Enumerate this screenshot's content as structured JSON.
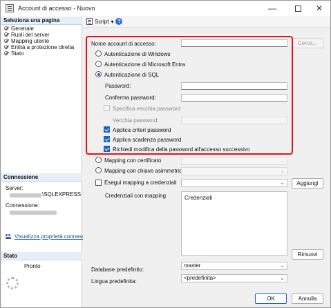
{
  "window": {
    "title": "Account di accesso - Nuovo",
    "minimize_glyph": "—",
    "close_glyph": "✕"
  },
  "sidebar": {
    "select_page_header": "Seleziona una pagina",
    "pages": [
      {
        "label": "Generale",
        "icon": "wrench-icon"
      },
      {
        "label": "Ruoli del server",
        "icon": "wrench-icon"
      },
      {
        "label": "Mapping utente",
        "icon": "wrench-icon"
      },
      {
        "label": "Entità a protezione diretta",
        "icon": "wrench-icon"
      },
      {
        "label": "Stato",
        "icon": "wrench-icon"
      }
    ],
    "connection_header": "Connessione",
    "server_label": "Server:",
    "server_value": "\\SQLEXPRESS",
    "connection_label": "Connessione:",
    "view_props_link": "Visualizza proprietà connessione",
    "status_header": "Stato",
    "status_value": "Pronto"
  },
  "toolbar": {
    "script_label": "Script",
    "dropdown_glyph": "▾",
    "help_glyph": "?"
  },
  "form": {
    "login_name_label": "Nome account di accesso:",
    "login_name_value": "",
    "search_button": "Cerca...",
    "auth_windows": "Autenticazione di Windows",
    "auth_entra": "Autenticazione di Microsoft Entra",
    "auth_sql": "Autenticazione di SQL",
    "auth_selected": "sql",
    "password_label": "Password:",
    "confirm_password_label": "Conferma password:",
    "specify_old_password": "Specifica vecchia password",
    "old_password_label": "Vecchia password:",
    "enforce_policy": "Applica criteri password",
    "enforce_policy_checked": true,
    "enforce_expiration": "Applica scadenza password",
    "enforce_expiration_checked": true,
    "must_change": "Richiedi modifica della password all'accesso successivo",
    "must_change_checked": true,
    "map_certificate": "Mapping con certificato",
    "map_asym_key": "Mapping con chiave asimmetrica",
    "map_credentials": "Esegui mapping a credenziali",
    "add_button": "Aggiungi",
    "mapped_credentials_label": "Credenziali con mapping",
    "credentials_column": "Credenziali",
    "remove_button": "Rimuovi",
    "default_db_label": "Database predefinito:",
    "default_db_value": "master",
    "default_lang_label": "Lingua predefinita:",
    "default_lang_value": "<predefinita>",
    "ok_button": "OK",
    "cancel_button": "Annulla"
  },
  "colors": {
    "highlight_border": "#e0141c",
    "accent": "#1b62c4",
    "link": "#1a4fa0"
  }
}
